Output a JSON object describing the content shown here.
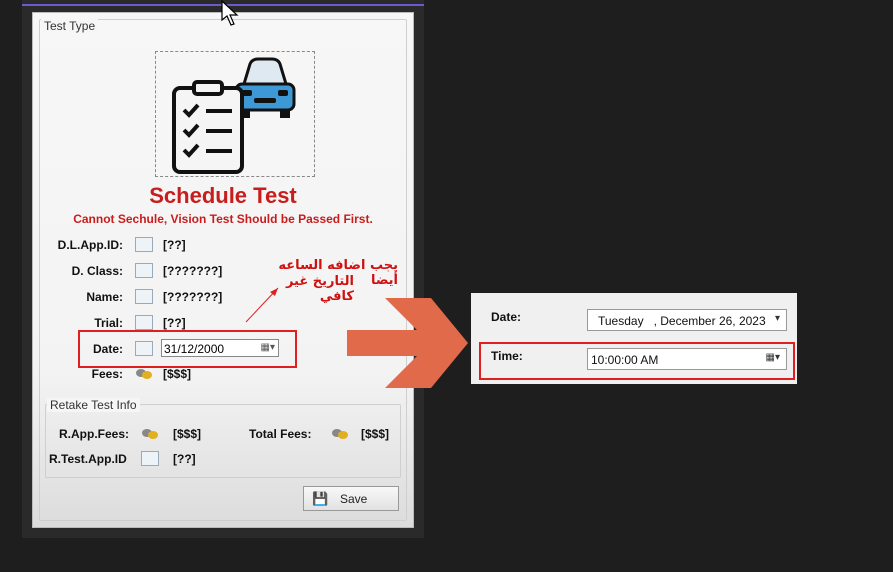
{
  "form": {
    "group_test_type": "Test Type",
    "title": "Schedule Test",
    "warning": "Cannot Sechule, Vision Test Should be Passed First.",
    "fields": [
      {
        "label": "D.L.App.ID:",
        "value": "[??]",
        "icon": "id-card-icon"
      },
      {
        "label": "D. Class:",
        "value": "[???????]",
        "icon": "license-class-icon"
      },
      {
        "label": "Name:",
        "value": "[???????]",
        "icon": "person-icon"
      },
      {
        "label": "Trial:",
        "value": "[??]",
        "icon": "trial-icon"
      },
      {
        "label": "Date:",
        "value": "31/12/2000",
        "icon": "calendar-icon"
      },
      {
        "label": "Fees:",
        "value": "[$$$]",
        "icon": "coins-icon"
      }
    ],
    "retake": {
      "title": "Retake Test Info",
      "app_fees_label": "R.App.Fees:",
      "app_fees_value": "[$$$]",
      "total_fees_label": "Total Fees:",
      "total_fees_value": "[$$$]",
      "test_app_id_label": "R.Test.App.ID",
      "test_app_id_value": "[??]"
    },
    "save_label": "Save"
  },
  "annotation": {
    "line1": "يجب اضافه الساعه أيضا",
    "line2": "التاريخ غير كافي"
  },
  "panel": {
    "date_label": "Date:",
    "date_value": "Tuesday   , December 26, 2023",
    "time_label": "Time:",
    "time_value": "10:00:00 AM"
  },
  "colors": {
    "title_red": "#c81d1d",
    "highlight_red": "#e02020",
    "arrow_orange": "#e06a4a"
  }
}
